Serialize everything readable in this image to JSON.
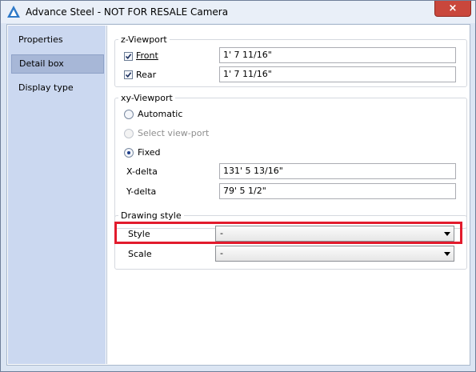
{
  "window": {
    "title": "Advance Steel - NOT FOR RESALE  Camera",
    "close_label": "×"
  },
  "sidebar": {
    "items": [
      {
        "label": "Properties",
        "selected": false
      },
      {
        "label": "Detail box",
        "selected": true
      },
      {
        "label": "Display type",
        "selected": false
      }
    ]
  },
  "z_viewport": {
    "title": "z-Viewport",
    "front": {
      "label": "Front",
      "checked": true,
      "value": "1' 7 11/16\""
    },
    "rear": {
      "label": "Rear",
      "checked": true,
      "value": "1' 7 11/16\""
    }
  },
  "xy_viewport": {
    "title": "xy-Viewport",
    "options": [
      {
        "label": "Automatic",
        "selected": false,
        "enabled": true
      },
      {
        "label": "Select view-port",
        "selected": false,
        "enabled": false
      },
      {
        "label": "Fixed",
        "selected": true,
        "enabled": true
      }
    ],
    "x_delta": {
      "label": "X-delta",
      "value": "131' 5 13/16\""
    },
    "y_delta": {
      "label": "Y-delta",
      "value": "79' 5 1/2\""
    }
  },
  "drawing_style": {
    "title": "Drawing style",
    "style": {
      "label": "Style",
      "value": "-"
    },
    "scale": {
      "label": "Scale",
      "value": "-"
    }
  },
  "colors": {
    "highlight": "#e21b2d",
    "sidebar_bg": "#cbd8f0",
    "selected_item_bg": "#a7b7d7"
  }
}
